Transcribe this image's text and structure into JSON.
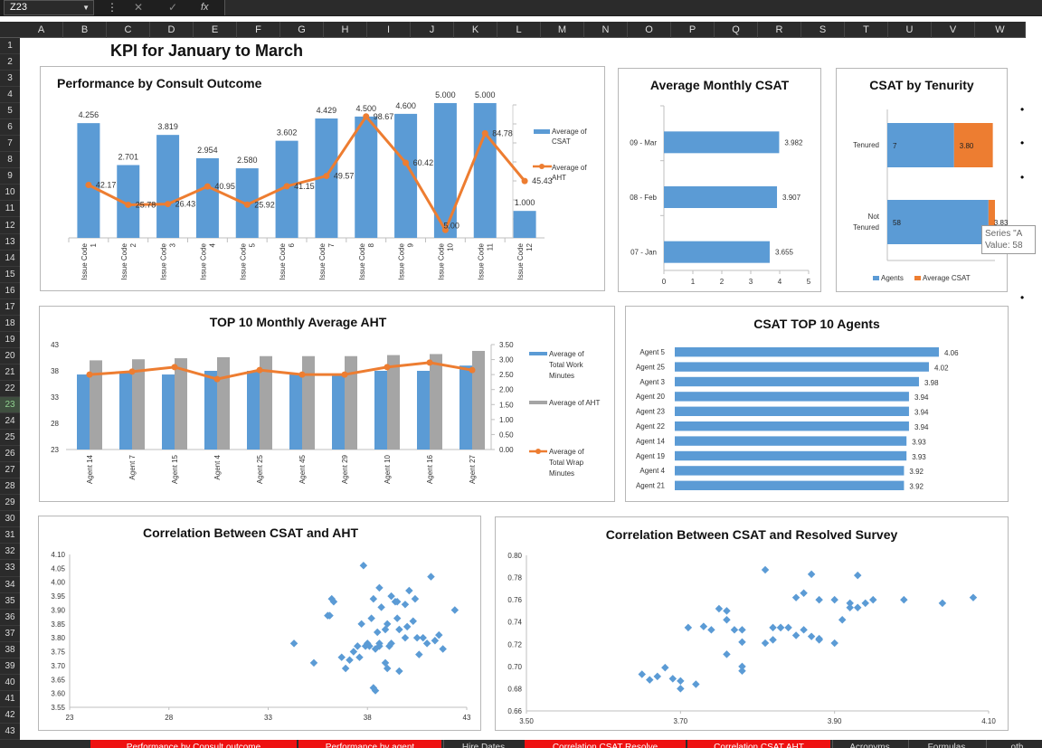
{
  "formula_bar": {
    "name_box": "Z23",
    "fx_label": "fx"
  },
  "columns": [
    "A",
    "B",
    "C",
    "D",
    "E",
    "F",
    "G",
    "H",
    "I",
    "J",
    "K",
    "L",
    "M",
    "N",
    "O",
    "P",
    "Q",
    "R",
    "S",
    "T",
    "U",
    "V",
    "W"
  ],
  "rows": [
    "1",
    "2",
    "3",
    "4",
    "5",
    "6",
    "7",
    "8",
    "9",
    "10",
    "11",
    "12",
    "13",
    "14",
    "15",
    "16",
    "17",
    "18",
    "19",
    "20",
    "21",
    "22",
    "23",
    "24",
    "25",
    "26",
    "27",
    "28",
    "29",
    "30",
    "31",
    "32",
    "33",
    "34",
    "35",
    "36",
    "37",
    "38",
    "39",
    "40",
    "41",
    "42",
    "43"
  ],
  "active_row": "23",
  "page_title": "KPI for January to March",
  "tooltip": {
    "line1": "Series \"A",
    "line2": "Value: 58"
  },
  "sheet_tabs": [
    {
      "label": "Performance by Consult outcome",
      "style": "red"
    },
    {
      "label": "Performance by agent",
      "style": "red"
    },
    {
      "label": "Hire Dates",
      "style": "plain"
    },
    {
      "label": "Correlation CSAT Resolve",
      "style": "red"
    },
    {
      "label": "Correlation CSAT AHT",
      "style": "red"
    },
    {
      "label": "Acronyms",
      "style": "plain"
    },
    {
      "label": "Formulas",
      "style": "plain"
    },
    {
      "label": "oth",
      "style": "plain"
    }
  ],
  "colors": {
    "blue": "#5b9bd5",
    "orange": "#ed7d31",
    "gray": "#a5a5a5"
  },
  "chart_data": [
    {
      "id": "consult",
      "type": "bar",
      "title": "Performance by Consult Outcome",
      "categories": [
        "Issue Code 1",
        "Issue Code 2",
        "Issue Code 3",
        "Issue Code 4",
        "Issue Code 5",
        "Issue Code 6",
        "Issue Code 7",
        "Issue Code 8",
        "Issue Code 9",
        "Issue Code 10",
        "Issue Code 11",
        "Issue Code 12"
      ],
      "cat_lines": [
        [
          "Issue Code",
          "1"
        ],
        [
          "Issue Code",
          "2"
        ],
        [
          "Issue Code",
          "3"
        ],
        [
          "Issue Code",
          "4"
        ],
        [
          "Issue Code",
          "5"
        ],
        [
          "Issue Code",
          "6"
        ],
        [
          "Issue Code",
          "7"
        ],
        [
          "Issue Code",
          "8"
        ],
        [
          "Issue Code",
          "9"
        ],
        [
          "Issue Code",
          "10"
        ],
        [
          "Issue Code",
          "11"
        ],
        [
          "Issue Code",
          "12"
        ]
      ],
      "series": [
        {
          "name": "Average of CSAT",
          "kind": "bar",
          "values": [
            4.256,
            2.701,
            3.819,
            2.954,
            2.58,
            3.602,
            4.429,
            4.5,
            4.6,
            5.0,
            5.0,
            1.0
          ],
          "labels": [
            "4.256",
            "2.701",
            "3.819",
            "2.954",
            "2.580",
            "3.602",
            "4.429",
            "4.500",
            "4.600",
            "5.000",
            "5.000",
            "1.000"
          ]
        },
        {
          "name": "Average of AHT",
          "kind": "line",
          "values": [
            42.17,
            25.78,
            26.43,
            40.95,
            25.92,
            41.15,
            49.57,
            98.67,
            60.42,
            5.0,
            84.78,
            45.43
          ],
          "labels": [
            "42.17",
            "25.78",
            "26.43",
            "40.95",
            "25.92",
            "41.15",
            "49.57",
            "98.67",
            "60.42",
            "5.00",
            "84.78",
            "45.43"
          ]
        }
      ],
      "legend": [
        "Average of CSAT",
        "Average of AHT"
      ],
      "legend_position": "right"
    },
    {
      "id": "monthly_csat",
      "type": "bar",
      "orientation": "horizontal",
      "title": "Average Monthly CSAT",
      "categories": [
        "09 - Mar",
        "08 - Feb",
        "07 - Jan"
      ],
      "values": [
        3.982,
        3.907,
        3.655
      ],
      "labels": [
        "3.982",
        "3.907",
        "3.655"
      ],
      "xlim": [
        0,
        5
      ],
      "xticks": [
        "0",
        "1",
        "2",
        "3",
        "4",
        "5"
      ]
    },
    {
      "id": "tenurity",
      "type": "bar",
      "orientation": "horizontal",
      "stacked": true,
      "title": "CSAT by Tenurity",
      "categories": [
        [
          "Tenured"
        ],
        [
          "Not",
          "Tenured"
        ]
      ],
      "series": [
        {
          "name": "Agents",
          "values": [
            7,
            58
          ],
          "labels": [
            "7",
            "58"
          ]
        },
        {
          "name": "Average CSAT",
          "values": [
            3.8,
            3.83
          ],
          "labels": [
            "3.80",
            "3.83"
          ]
        }
      ],
      "legend": [
        "Agents",
        "Average CSAT"
      ],
      "legend_position": "bottom"
    },
    {
      "id": "aht_top10",
      "type": "bar",
      "title": "TOP 10 Monthly Average AHT",
      "categories": [
        "Agent 14",
        "Agent 7",
        "Agent 15",
        "Agent 4",
        "Agent 25",
        "Agent 45",
        "Agent 29",
        "Agent 10",
        "Agent 16",
        "Agent 27"
      ],
      "series": [
        {
          "name": "Average of Total Work Minutes",
          "kind": "bar",
          "axis": "left",
          "values": [
            37.3,
            37.7,
            37.3,
            38.0,
            38.0,
            37.3,
            37.3,
            38.0,
            38.0,
            39.0
          ]
        },
        {
          "name": "Average of AHT",
          "kind": "bar",
          "axis": "left",
          "values": [
            40.0,
            40.2,
            40.4,
            40.6,
            40.8,
            40.8,
            40.8,
            41.0,
            41.2,
            41.8
          ]
        },
        {
          "name": "Average of Total Wrap Minutes",
          "kind": "line",
          "axis": "right",
          "values": [
            2.5,
            2.6,
            2.75,
            2.35,
            2.65,
            2.5,
            2.5,
            2.75,
            2.9,
            2.65
          ]
        }
      ],
      "ylim": [
        23,
        43
      ],
      "yticks": [
        "23",
        "28",
        "33",
        "38",
        "43"
      ],
      "y2lim": [
        0,
        3.5
      ],
      "y2ticks": [
        "0.00",
        "0.50",
        "1.00",
        "1.50",
        "2.00",
        "2.50",
        "3.00",
        "3.50"
      ],
      "legend": [
        "Average of Total Work Minutes",
        "Average of AHT",
        "Average of Total Wrap Minutes"
      ],
      "legend_lines": [
        [
          "Average of",
          "Total Work",
          "Minutes"
        ],
        [
          "Average of AHT"
        ],
        [
          "Average of",
          "Total Wrap",
          "Minutes"
        ]
      ],
      "legend_position": "right"
    },
    {
      "id": "csat_top10",
      "type": "bar",
      "orientation": "horizontal",
      "title": "CSAT TOP 10 Agents",
      "categories": [
        "Agent 5",
        "Agent 25",
        "Agent 3",
        "Agent 20",
        "Agent 23",
        "Agent 22",
        "Agent 14",
        "Agent 19",
        "Agent 4",
        "Agent 21"
      ],
      "values": [
        4.06,
        4.02,
        3.98,
        3.94,
        3.94,
        3.94,
        3.93,
        3.93,
        3.92,
        3.92
      ],
      "labels": [
        "4.06",
        "4.02",
        "3.98",
        "3.94",
        "3.94",
        "3.94",
        "3.93",
        "3.93",
        "3.92",
        "3.92"
      ]
    },
    {
      "id": "scatter_aht",
      "type": "scatter",
      "title": "Correlation Between CSAT and AHT",
      "xlim": [
        23,
        43
      ],
      "xticks": [
        "23",
        "28",
        "33",
        "38",
        "43"
      ],
      "ylim": [
        3.55,
        4.1
      ],
      "yticks": [
        "3.55",
        "3.60",
        "3.65",
        "3.70",
        "3.75",
        "3.80",
        "3.85",
        "3.90",
        "3.95",
        "4.00",
        "4.05",
        "4.10"
      ],
      "x": [
        37.8,
        41.2,
        38.6,
        40.1,
        36.2,
        36.3,
        38.3,
        38.7,
        39.2,
        39.4,
        39.9,
        40.4,
        42.4,
        36.0,
        37.7,
        38.2,
        38.9,
        39.5,
        40.3,
        40.0,
        38.5,
        39.0,
        39.6,
        41.6,
        34.3,
        35.3,
        36.7,
        37.3,
        37.9,
        38.0,
        38.4,
        38.6,
        39.1,
        39.9,
        40.5,
        41.0,
        41.4,
        41.8,
        36.9,
        37.1,
        37.6,
        38.1,
        38.6,
        39.2,
        38.9,
        37.5,
        38.3,
        38.4,
        39.6,
        40.8,
        36.1,
        39.0,
        40.6,
        39.5
      ],
      "y": [
        4.06,
        4.02,
        3.98,
        3.97,
        3.94,
        3.93,
        3.94,
        3.91,
        3.95,
        3.93,
        3.92,
        3.94,
        3.9,
        3.88,
        3.85,
        3.87,
        3.83,
        3.87,
        3.86,
        3.84,
        3.82,
        3.85,
        3.83,
        3.81,
        3.78,
        3.71,
        3.73,
        3.75,
        3.77,
        3.78,
        3.76,
        3.78,
        3.77,
        3.8,
        3.8,
        3.78,
        3.79,
        3.76,
        3.69,
        3.72,
        3.73,
        3.77,
        3.77,
        3.78,
        3.71,
        3.77,
        3.62,
        3.61,
        3.68,
        3.8,
        3.88,
        3.69,
        3.74,
        3.93
      ]
    },
    {
      "id": "scatter_resolved",
      "type": "scatter",
      "title": "Correlation Between CSAT and Resolved Survey",
      "xlim": [
        3.5,
        4.1
      ],
      "xticks": [
        "3.50",
        "3.70",
        "3.90",
        "4.10"
      ],
      "ylim": [
        0.66,
        0.8
      ],
      "yticks": [
        "0.66",
        "0.68",
        "0.70",
        "0.72",
        "0.74",
        "0.76",
        "0.78",
        "0.80"
      ],
      "x": [
        3.81,
        3.87,
        3.93,
        3.86,
        3.85,
        3.88,
        3.92,
        3.92,
        3.94,
        3.95,
        3.99,
        4.04,
        4.08,
        3.75,
        3.76,
        3.76,
        3.82,
        3.84,
        3.86,
        3.83,
        3.87,
        3.91,
        3.71,
        3.73,
        3.74,
        3.77,
        3.78,
        3.78,
        3.81,
        3.83,
        3.82,
        3.85,
        3.88,
        3.9,
        3.93,
        3.67,
        3.68,
        3.69,
        3.7,
        3.7,
        3.72,
        3.76,
        3.78,
        3.78,
        3.66,
        3.65,
        3.88,
        3.9
      ],
      "y": [
        0.787,
        0.783,
        0.782,
        0.766,
        0.762,
        0.76,
        0.757,
        0.753,
        0.757,
        0.76,
        0.76,
        0.757,
        0.762,
        0.752,
        0.75,
        0.742,
        0.735,
        0.735,
        0.733,
        0.735,
        0.727,
        0.742,
        0.735,
        0.736,
        0.733,
        0.733,
        0.733,
        0.722,
        0.721,
        0.735,
        0.724,
        0.728,
        0.725,
        0.721,
        0.753,
        0.691,
        0.699,
        0.689,
        0.687,
        0.68,
        0.684,
        0.711,
        0.7,
        0.696,
        0.688,
        0.693,
        0.724,
        0.76
      ]
    }
  ]
}
